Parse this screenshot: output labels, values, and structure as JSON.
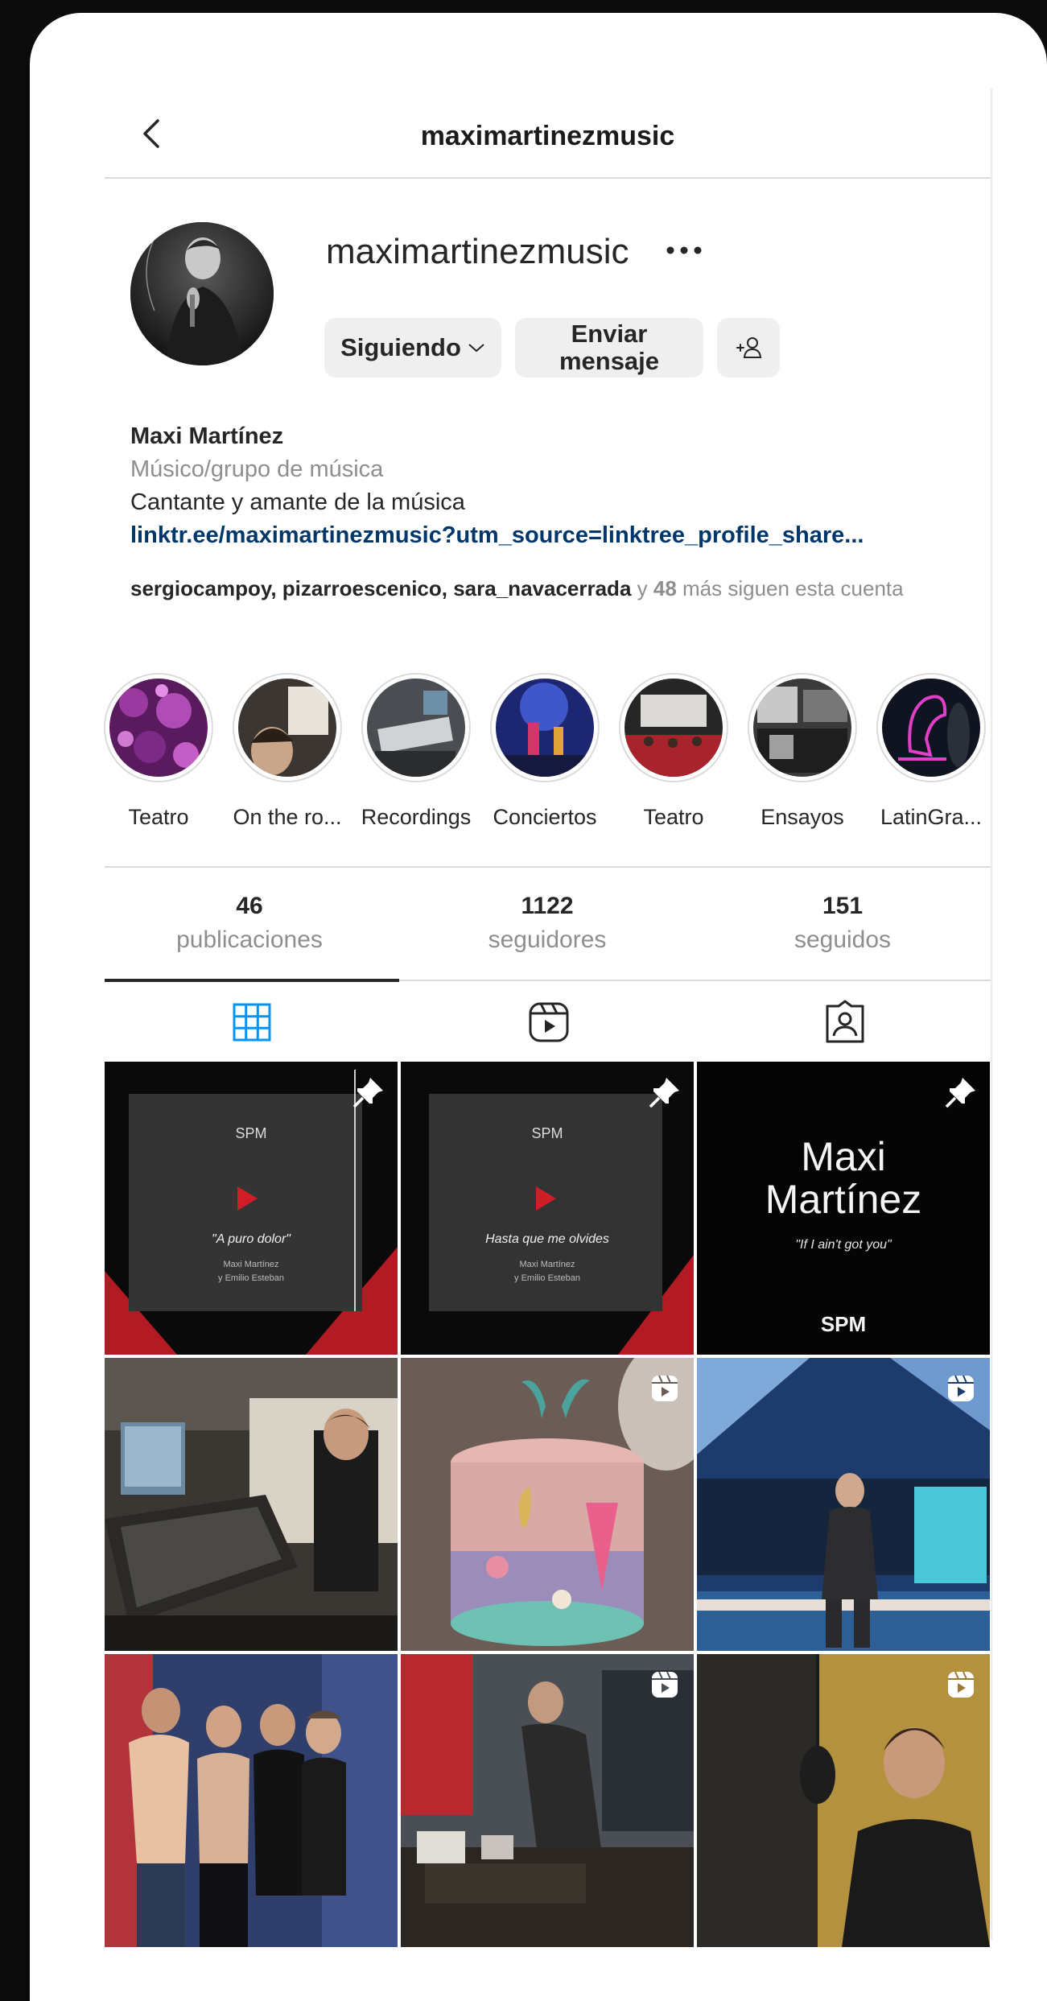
{
  "header": {
    "title": "maximartinezmusic"
  },
  "profile": {
    "username": "maximartinezmusic",
    "follow_label": "Siguiendo",
    "message_label_line1": "Enviar",
    "message_label_line2": "mensaje"
  },
  "bio": {
    "name": "Maxi Martínez",
    "category": "Músico/grupo de música",
    "description": "Cantante y amante de la música",
    "link": "linktr.ee/maximartinezmusic?utm_source=linktree_profile_share..."
  },
  "followed_by": {
    "users": "sergiocampoy, pizarroescenico, sara_navacerrada",
    "connector": " y ",
    "count": "48",
    "suffix": " más siguen esta cuenta"
  },
  "highlights": [
    {
      "label": "Teatro"
    },
    {
      "label": "On the ro..."
    },
    {
      "label": "Recordings"
    },
    {
      "label": "Conciertos"
    },
    {
      "label": "Teatro"
    },
    {
      "label": "Ensayos"
    },
    {
      "label": "LatinGra..."
    }
  ],
  "stats": [
    {
      "number": "46",
      "label": "publicaciones"
    },
    {
      "number": "1122",
      "label": "seguidores"
    },
    {
      "number": "151",
      "label": "seguidos"
    }
  ],
  "tabs": [
    {
      "icon": "grid-icon",
      "active": true
    },
    {
      "icon": "reels-icon",
      "active": false
    },
    {
      "icon": "tagged-icon",
      "active": false
    }
  ],
  "posts": [
    {
      "caption": "\"A puro dolor\"",
      "credit1": "Maxi Martínez",
      "credit2": "y Emilio Esteban",
      "logo": "SPM",
      "badge": "pin-icon"
    },
    {
      "caption": "Hasta que me olvides",
      "credit1": "Maxi Martínez",
      "credit2": "y Emilio Esteban",
      "logo": "SPM",
      "badge": "pin-icon"
    },
    {
      "title1": "Maxi",
      "title2": "Martínez",
      "subtitle": "\"If I ain't got you\"",
      "logo": "SPM",
      "badge": "pin-icon"
    },
    {
      "badge": ""
    },
    {
      "badge": "reel-icon"
    },
    {
      "badge": "reel-icon"
    },
    {
      "badge": ""
    },
    {
      "badge": "reel-icon"
    },
    {
      "badge": "reel-icon"
    }
  ],
  "colors": {
    "link": "#00376b",
    "secondary_text": "#8e8e8e",
    "button_bg": "#efefef",
    "active_tab_icon": "#0095f6"
  }
}
